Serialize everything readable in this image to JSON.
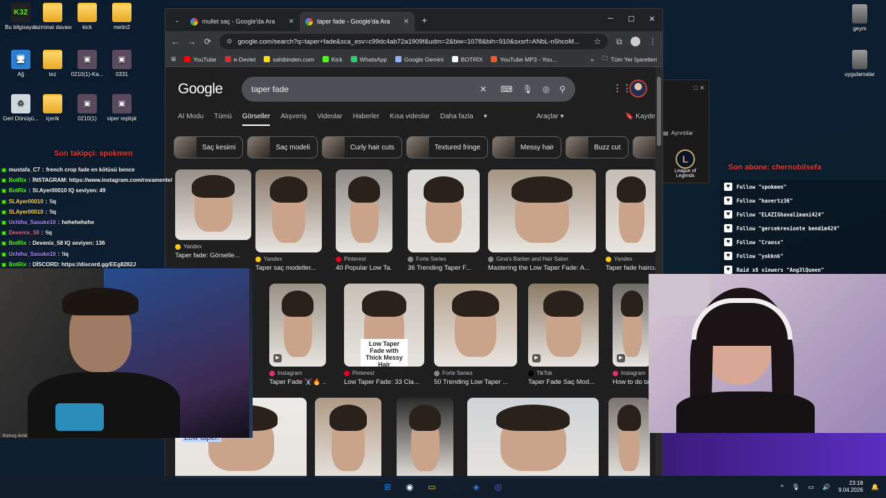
{
  "desktop": {
    "icons_left": [
      {
        "label": "Bu bilgisayar",
        "icon": "k32-logo-icon"
      },
      {
        "label": "tazminat davası",
        "icon": "folder-icon"
      },
      {
        "label": "kick",
        "icon": "folder-icon"
      },
      {
        "label": "metin2",
        "icon": "folder-icon"
      },
      {
        "label": "Ağ",
        "icon": "network-icon"
      },
      {
        "label": "tez",
        "icon": "folder-icon"
      },
      {
        "label": "0210(1)-Ka...",
        "icon": "file-icon"
      },
      {
        "label": "0331",
        "icon": "file-icon"
      },
      {
        "label": "Geri Dönüşü...",
        "icon": "recycle-bin-icon"
      },
      {
        "label": "içerik",
        "icon": "folder-icon"
      },
      {
        "label": "0210(1)",
        "icon": "file-icon"
      },
      {
        "label": "viper replişk",
        "icon": "file-icon"
      }
    ],
    "icons_right": [
      {
        "label": "geym",
        "icon": "archive-icon"
      },
      {
        "label": "uygulamalar",
        "icon": "archive-icon"
      }
    ],
    "lol_label": "League of Legends",
    "lol_detail": "Ayrıntılar"
  },
  "browser": {
    "tabs": [
      {
        "title": "mullet saç - Google'da Ara",
        "active": false
      },
      {
        "title": "taper fade - Google'da Ara",
        "active": true
      }
    ],
    "url": "google.com/search?q=taper+fade&sca_esv=c99dc4ab72a1909f&udm=2&biw=1078&bih=910&sxsrf=ANbL-n5hcoM...",
    "bookmarks": [
      {
        "label": "YouTube",
        "color": "#ff0000"
      },
      {
        "label": "e-Devlet",
        "color": "#d32f2f"
      },
      {
        "label": "sahibinden.com",
        "color": "#ffe100"
      },
      {
        "label": "Kick",
        "color": "#53fc18"
      },
      {
        "label": "WhatsApp",
        "color": "#25d366"
      },
      {
        "label": "Google Gemini",
        "color": "#8ab4f8"
      },
      {
        "label": "BOTRİX",
        "color": "#ffffff"
      },
      {
        "label": "YouTube MP3 - You...",
        "color": "#ff5722"
      }
    ],
    "all_bookmarks": "Tüm Yer İşaretleri"
  },
  "google": {
    "logo": "Google",
    "query": "taper fade",
    "filters": [
      "AI Modu",
      "Tümü",
      "Görseller",
      "Alışveriş",
      "Videolar",
      "Haberler",
      "Kısa videolar",
      "Daha fazla"
    ],
    "active_filter": "Görseller",
    "tools": "Araçlar",
    "saved": "Kaydedilenler",
    "chips": [
      "Saç kesimi",
      "Saç modeli",
      "Curly hair cuts",
      "Textured fringe",
      "Messy hair",
      "Buzz cut"
    ],
    "row1": [
      {
        "source": "Yandex",
        "title": "Taper fade: Görselle...",
        "color": "#9a8f86",
        "sdot": "#ffcc00"
      },
      {
        "source": "Yandex",
        "title": "Taper saç modeller...",
        "color": "#8b7a6c",
        "sdot": "#ffcc00"
      },
      {
        "source": "Pinterest",
        "title": "40 Popular Low Ta...",
        "color": "#8e8a86",
        "sdot": "#e60023"
      },
      {
        "source": "Forte Series",
        "title": "36 Trending Taper F...",
        "color": "#d8d6d3",
        "sdot": "#888888"
      },
      {
        "source": "Gina's Barber and Hair Salon",
        "title": "Mastering the Low Taper Fade: A...",
        "color": "#a49584",
        "sdot": "#888888"
      },
      {
        "source": "Yandex",
        "title": "Taper fade haircu...",
        "color": "#c6bdb4",
        "sdot": "#ffcc00"
      }
    ],
    "row2": [
      {
        "source": "Instagram",
        "title": "Taper Fade ✂️🔥 ...",
        "color": "#9a9186",
        "sdot": "#e1306c"
      },
      {
        "source": "Pinterest",
        "title": "Low Taper Fade: 33 Cla...",
        "color": "#c7c1b8",
        "sdot": "#e60023",
        "overlay": "Low Taper Fade with Thick Messy Hair"
      },
      {
        "source": "Forte Series",
        "title": "50 Trending Low Taper ...",
        "color": "#b5a48f",
        "sdot": "#888888"
      },
      {
        "source": "TikTok",
        "title": "Taper Fade Saç Mod...",
        "color": "#8c7b66",
        "sdot": "#000000"
      },
      {
        "source": "Instagram",
        "title": "How to do ta...",
        "color": "#6e6a66",
        "sdot": "#e1306c"
      }
    ],
    "row3_overlay": "Low taper."
  },
  "stream": {
    "chat": [
      {
        "user": "mustafa_C7",
        "text": "french crop fade en kötüsü bence",
        "color": "#ffffff"
      },
      {
        "user": "BotRix",
        "text": "İNSTAGRAM: https://www.instagram.com/rovamente/",
        "color": "#53fc18"
      },
      {
        "user": "BotRix",
        "text": "Sl.Ayer00010 IQ seviyen: 49",
        "color": "#53fc18"
      },
      {
        "user": "SLAyer00010",
        "text": "!iq",
        "color": "#ffd54f"
      },
      {
        "user": "SLAyer00010",
        "text": "!iq",
        "color": "#ffd54f"
      },
      {
        "user": "Uchiha_Sasuke10",
        "text": "hehehehehe",
        "color": "#b388ff"
      },
      {
        "user": "Devenix_58",
        "text": "!iq",
        "color": "#f06292"
      },
      {
        "user": "BotRix",
        "text": "Devenix_58 IQ seviyen: 136",
        "color": "#53fc18"
      },
      {
        "user": "Uchiha_Sasuke10",
        "text": "!iq",
        "color": "#b388ff"
      },
      {
        "user": "BotRix",
        "text": "DİSCORD: https://discord.gg/EEg8282J",
        "color": "#53fc18"
      }
    ],
    "last_sub_left": "Son takipçi: spokmen",
    "last_sub_right": "Son abone: chernobilsefa",
    "follows": [
      "Follow \"spokmen\"",
      "Follow \"havertz36\"",
      "Follow \"ELAZIGhavalimani424\"",
      "Follow \"gercekrevionte bendim424\"",
      "Follow \"Craosx\"",
      "Follow \"yokknk\"",
      "Raid x8 viewers \"Ang3lQueen\""
    ]
  },
  "taskbar": {
    "apps": [
      "windows-start-icon",
      "chrome-icon",
      "file-explorer-icon",
      "obs-icon",
      "app-icon",
      "discord-icon"
    ],
    "time": "23:18",
    "date": "9.04.2026",
    "bottom_left_label": "Konuş Artık"
  }
}
